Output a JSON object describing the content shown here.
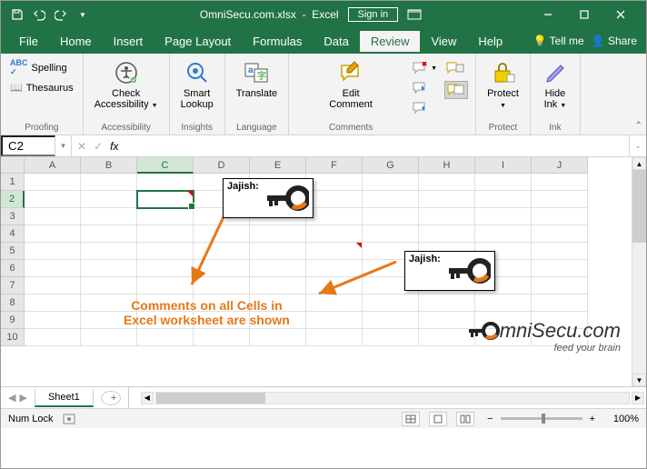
{
  "titlebar": {
    "filename": "OmniSecu.com.xlsx",
    "appname": "Excel",
    "signin": "Sign in"
  },
  "tabs": {
    "file": "File",
    "home": "Home",
    "insert": "Insert",
    "pagelayout": "Page Layout",
    "formulas": "Formulas",
    "data": "Data",
    "review": "Review",
    "view": "View",
    "help": "Help",
    "tellme": "Tell me",
    "share": "Share"
  },
  "ribbon": {
    "proofing": {
      "spelling": "Spelling",
      "thesaurus": "Thesaurus",
      "label": "Proofing"
    },
    "accessibility": {
      "btn": "Check\nAccessibility",
      "label": "Accessibility"
    },
    "insights": {
      "btn": "Smart\nLookup",
      "label": "Insights"
    },
    "language": {
      "btn": "Translate",
      "label": "Language"
    },
    "comments": {
      "btn": "Edit\nComment",
      "label": "Comments"
    },
    "protect": {
      "btn": "Protect",
      "label": "Protect"
    },
    "ink": {
      "btn": "Hide\nInk",
      "label": "Ink"
    }
  },
  "namebox": {
    "value": "C2"
  },
  "formula": {
    "fx": "fx"
  },
  "columns": [
    "A",
    "B",
    "C",
    "D",
    "E",
    "F",
    "G",
    "H",
    "I",
    "J"
  ],
  "rows": [
    "1",
    "2",
    "3",
    "4",
    "5",
    "6",
    "7",
    "8",
    "9",
    "10"
  ],
  "active_col": "C",
  "active_row": "2",
  "comments": [
    {
      "author": "Jajish:"
    },
    {
      "author": "Jajish:"
    }
  ],
  "annotation": {
    "line1": "Comments on all Cells in",
    "line2": "Excel worksheet are shown"
  },
  "watermark": {
    "main": "mniSecu.com",
    "sub": "feed your brain"
  },
  "sheettabs": {
    "sheet1": "Sheet1"
  },
  "statusbar": {
    "numlock": "Num Lock",
    "zoom": "100%",
    "minus": "−",
    "plus": "+"
  }
}
